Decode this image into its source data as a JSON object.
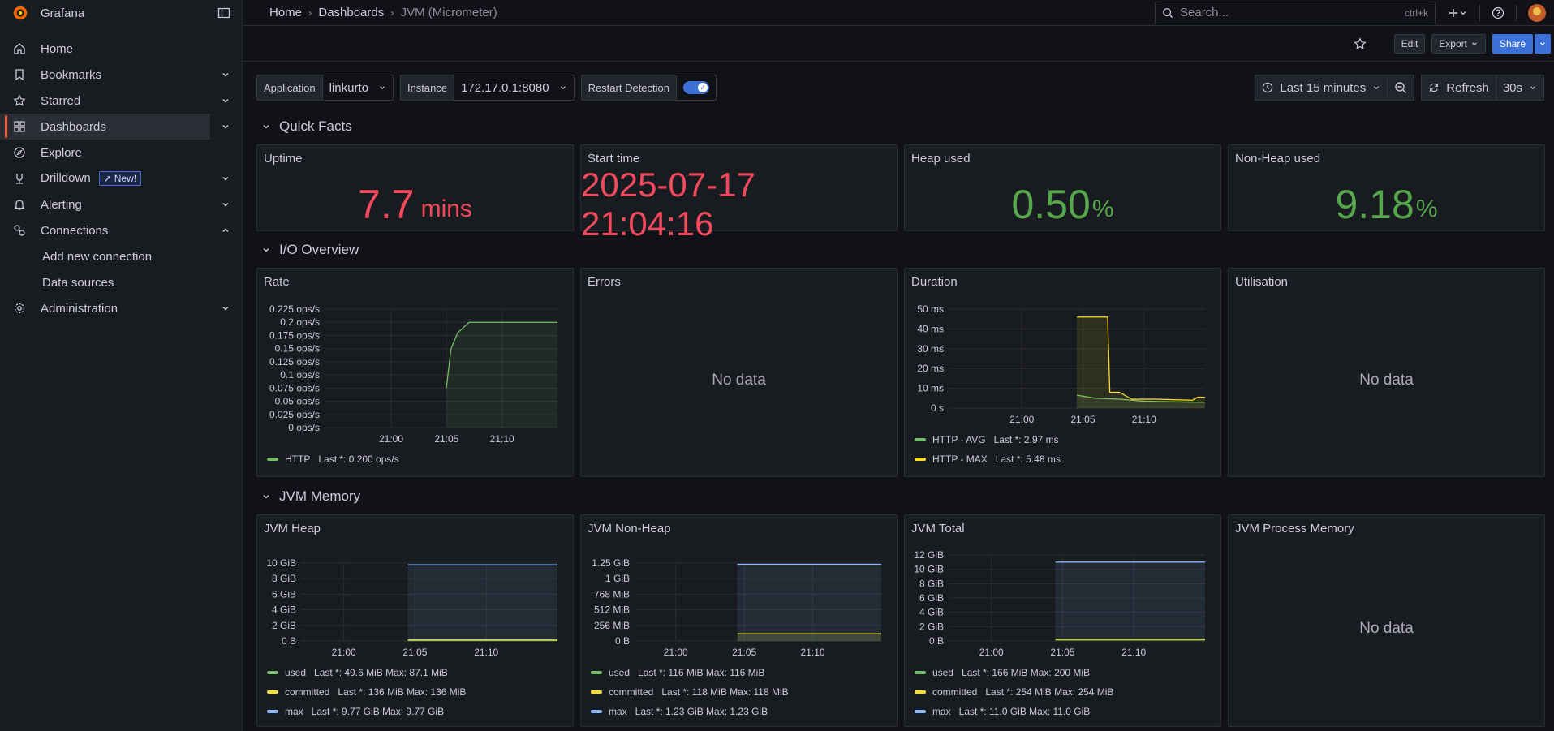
{
  "app": {
    "name": "Grafana"
  },
  "sidebar": {
    "items": [
      {
        "label": "Home",
        "icon": "home-icon"
      },
      {
        "label": "Bookmarks",
        "icon": "bookmark-icon"
      },
      {
        "label": "Starred",
        "icon": "star-icon"
      },
      {
        "label": "Dashboards",
        "icon": "apps-icon"
      },
      {
        "label": "Explore",
        "icon": "compass-icon"
      },
      {
        "label": "Drilldown",
        "icon": "drilldown-icon",
        "badge": "New!"
      },
      {
        "label": "Alerting",
        "icon": "bell-icon"
      },
      {
        "label": "Connections",
        "icon": "link-icon"
      },
      {
        "label": "Add new connection"
      },
      {
        "label": "Data sources"
      },
      {
        "label": "Administration",
        "icon": "cog-icon"
      }
    ]
  },
  "topbar": {
    "breadcrumbs": [
      "Home",
      "Dashboards",
      "JVM (Micrometer)"
    ],
    "search_placeholder": "Search...",
    "search_shortcut": "ctrl+k"
  },
  "toolbar": {
    "edit": "Edit",
    "export": "Export",
    "share": "Share"
  },
  "variables": {
    "application": {
      "label": "Application",
      "value": "linkurto"
    },
    "instance": {
      "label": "Instance",
      "value": "172.17.0.1:8080"
    },
    "restart": {
      "label": "Restart Detection",
      "enabled": true
    }
  },
  "time": {
    "range": "Last 15 minutes",
    "refresh": "Refresh",
    "interval": "30s"
  },
  "colors": {
    "red": "#f2495c",
    "green": "#56a64b",
    "yellow": "#fade2a",
    "blue": "#8ab8ff",
    "accent": "#3d71d9"
  },
  "rows": {
    "quick_facts": "Quick Facts",
    "io_overview": "I/O Overview",
    "jvm_memory": "JVM Memory"
  },
  "quick_facts": {
    "uptime": {
      "title": "Uptime",
      "value": "7.7",
      "unit": "mins"
    },
    "start_time": {
      "title": "Start time",
      "value": "2025-07-17 21:04:16"
    },
    "heap_used": {
      "title": "Heap used",
      "value": "0.50",
      "unit": "%"
    },
    "nonheap_used": {
      "title": "Non-Heap used",
      "value": "9.18",
      "unit": "%"
    }
  },
  "io": {
    "rate": {
      "title": "Rate"
    },
    "errors": {
      "title": "Errors",
      "nodata": "No data"
    },
    "duration": {
      "title": "Duration"
    },
    "utilisation": {
      "title": "Utilisation",
      "nodata": "No data"
    }
  },
  "memory": {
    "heap": {
      "title": "JVM Heap"
    },
    "nonheap": {
      "title": "JVM Non-Heap"
    },
    "total": {
      "title": "JVM Total"
    },
    "process": {
      "title": "JVM Process Memory",
      "nodata": "No data"
    }
  },
  "legends": {
    "rate": [
      {
        "name": "HTTP",
        "stats": "Last *: 0.200 ops/s"
      }
    ],
    "duration": [
      {
        "name": "HTTP - AVG",
        "stats": "Last *: 2.97 ms"
      },
      {
        "name": "HTTP - MAX",
        "stats": "Last *: 5.48 ms"
      }
    ],
    "heap": [
      {
        "name": "used",
        "stats": "Last *: 49.6 MiB   Max: 87.1 MiB"
      },
      {
        "name": "committed",
        "stats": "Last *: 136 MiB   Max: 136 MiB"
      },
      {
        "name": "max",
        "stats": "Last *: 9.77 GiB   Max: 9.77 GiB"
      }
    ],
    "nonheap": [
      {
        "name": "used",
        "stats": "Last *: 116 MiB   Max: 116 MiB"
      },
      {
        "name": "committed",
        "stats": "Last *: 118 MiB   Max: 118 MiB"
      },
      {
        "name": "max",
        "stats": "Last *: 1.23 GiB   Max: 1.23 GiB"
      }
    ],
    "total": [
      {
        "name": "used",
        "stats": "Last *: 166 MiB   Max: 200 MiB"
      },
      {
        "name": "committed",
        "stats": "Last *: 254 MiB   Max: 254 MiB"
      },
      {
        "name": "max",
        "stats": "Last *: 11.0 GiB   Max: 11.0 GiB"
      }
    ]
  },
  "chart_data": [
    {
      "id": "rate",
      "type": "line",
      "x_ticks": [
        "21:00",
        "21:05",
        "21:10"
      ],
      "y_ticks": [
        "0 ops/s",
        "0.025 ops/s",
        "0.05 ops/s",
        "0.075 ops/s",
        "0.1 ops/s",
        "0.125 ops/s",
        "0.15 ops/s",
        "0.175 ops/s",
        "0.2 ops/s",
        "0.225 ops/s"
      ],
      "ylim": [
        0,
        0.225
      ],
      "series": [
        {
          "name": "HTTP",
          "color": "#73bf69",
          "x": [
            21.083,
            21.09,
            21.1,
            21.117,
            21.25
          ],
          "y": [
            0.075,
            0.15,
            0.18,
            0.2,
            0.2
          ]
        }
      ]
    },
    {
      "id": "duration",
      "type": "line",
      "x_ticks": [
        "21:00",
        "21:05",
        "21:10"
      ],
      "y_ticks": [
        "0 s",
        "10 ms",
        "20 ms",
        "30 ms",
        "40 ms",
        "50 ms"
      ],
      "ylim": [
        0,
        50
      ],
      "series": [
        {
          "name": "HTTP - AVG",
          "color": "#73bf69",
          "x": [
            21.075,
            21.1,
            21.133,
            21.167,
            21.2,
            21.233,
            21.25
          ],
          "y": [
            6.5,
            5,
            4.5,
            3.5,
            3.2,
            3,
            2.97
          ]
        },
        {
          "name": "HTTP - MAX",
          "color": "#fade2a",
          "x": [
            21.075,
            21.117,
            21.12,
            21.133,
            21.15,
            21.183,
            21.233,
            21.24,
            21.25
          ],
          "y": [
            46,
            46,
            8,
            8,
            4.5,
            4.5,
            4,
            5.5,
            5.48
          ]
        }
      ]
    },
    {
      "id": "heap",
      "type": "line",
      "x_ticks": [
        "21:00",
        "21:05",
        "21:10"
      ],
      "y_ticks": [
        "0 B",
        "2 GiB",
        "4 GiB",
        "6 GiB",
        "8 GiB",
        "10 GiB"
      ],
      "ylim": [
        0,
        10
      ],
      "series": [
        {
          "name": "used",
          "color": "#73bf69",
          "x": [
            21.075,
            21.25
          ],
          "y": [
            0.05,
            0.05
          ]
        },
        {
          "name": "committed",
          "color": "#fade2a",
          "x": [
            21.075,
            21.25
          ],
          "y": [
            0.13,
            0.13
          ]
        },
        {
          "name": "max",
          "color": "#8ab8ff",
          "x": [
            21.075,
            21.25
          ],
          "y": [
            9.77,
            9.77
          ]
        }
      ]
    },
    {
      "id": "nonheap",
      "type": "line",
      "x_ticks": [
        "21:00",
        "21:05",
        "21:10"
      ],
      "y_ticks": [
        "0 B",
        "256 MiB",
        "512 MiB",
        "768 MiB",
        "1 GiB",
        "1.25 GiB"
      ],
      "ylim": [
        0,
        1280
      ],
      "series": [
        {
          "name": "used",
          "color": "#73bf69",
          "x": [
            21.075,
            21.25
          ],
          "y": [
            116,
            116
          ]
        },
        {
          "name": "committed",
          "color": "#fade2a",
          "x": [
            21.075,
            21.25
          ],
          "y": [
            118,
            118
          ]
        },
        {
          "name": "max",
          "color": "#8ab8ff",
          "x": [
            21.075,
            21.25
          ],
          "y": [
            1260,
            1260
          ]
        }
      ]
    },
    {
      "id": "total",
      "type": "line",
      "x_ticks": [
        "21:00",
        "21:05",
        "21:10"
      ],
      "y_ticks": [
        "0 B",
        "2 GiB",
        "4 GiB",
        "6 GiB",
        "8 GiB",
        "10 GiB",
        "12 GiB"
      ],
      "ylim": [
        0,
        12
      ],
      "series": [
        {
          "name": "used",
          "color": "#73bf69",
          "x": [
            21.075,
            21.25
          ],
          "y": [
            0.16,
            0.16
          ]
        },
        {
          "name": "committed",
          "color": "#fade2a",
          "x": [
            21.075,
            21.25
          ],
          "y": [
            0.25,
            0.25
          ]
        },
        {
          "name": "max",
          "color": "#8ab8ff",
          "x": [
            21.075,
            21.25
          ],
          "y": [
            11.0,
            11.0
          ]
        }
      ]
    }
  ]
}
